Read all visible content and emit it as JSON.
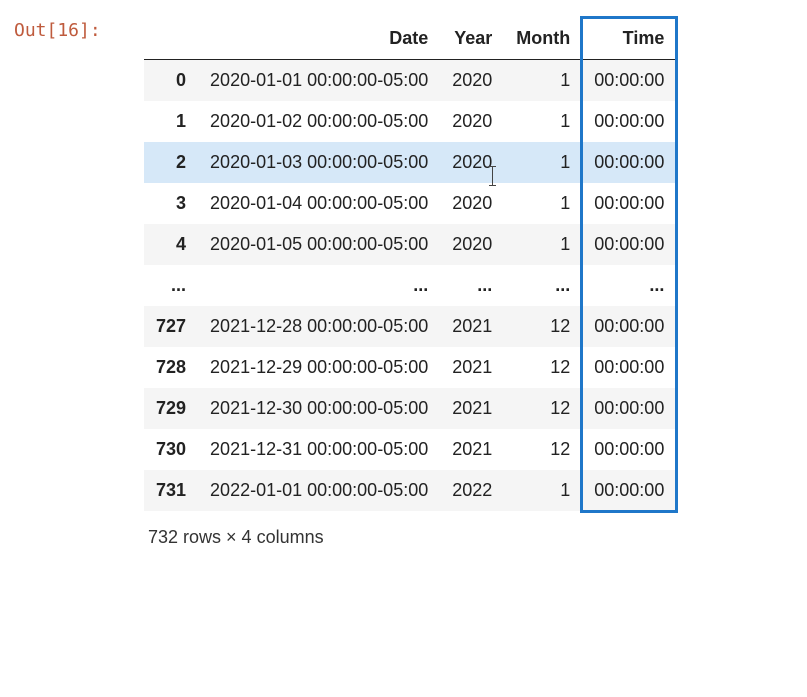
{
  "out_label": "Out[16]:",
  "columns": [
    "Date",
    "Year",
    "Month",
    "Time"
  ],
  "rows": [
    {
      "idx": "0",
      "Date": "2020-01-01 00:00:00-05:00",
      "Year": "2020",
      "Month": "1",
      "Time": "00:00:00",
      "parity": "odd"
    },
    {
      "idx": "1",
      "Date": "2020-01-02 00:00:00-05:00",
      "Year": "2020",
      "Month": "1",
      "Time": "00:00:00",
      "parity": "even"
    },
    {
      "idx": "2",
      "Date": "2020-01-03 00:00:00-05:00",
      "Year": "2020",
      "Month": "1",
      "Time": "00:00:00",
      "parity": "highlight",
      "cursor": true
    },
    {
      "idx": "3",
      "Date": "2020-01-04 00:00:00-05:00",
      "Year": "2020",
      "Month": "1",
      "Time": "00:00:00",
      "parity": "even"
    },
    {
      "idx": "4",
      "Date": "2020-01-05 00:00:00-05:00",
      "Year": "2020",
      "Month": "1",
      "Time": "00:00:00",
      "parity": "odd"
    },
    {
      "idx": "...",
      "Date": "...",
      "Year": "...",
      "Month": "...",
      "Time": "...",
      "parity": "even",
      "ellipsis": true
    },
    {
      "idx": "727",
      "Date": "2021-12-28 00:00:00-05:00",
      "Year": "2021",
      "Month": "12",
      "Time": "00:00:00",
      "parity": "odd"
    },
    {
      "idx": "728",
      "Date": "2021-12-29 00:00:00-05:00",
      "Year": "2021",
      "Month": "12",
      "Time": "00:00:00",
      "parity": "even"
    },
    {
      "idx": "729",
      "Date": "2021-12-30 00:00:00-05:00",
      "Year": "2021",
      "Month": "12",
      "Time": "00:00:00",
      "parity": "odd"
    },
    {
      "idx": "730",
      "Date": "2021-12-31 00:00:00-05:00",
      "Year": "2021",
      "Month": "12",
      "Time": "00:00:00",
      "parity": "even"
    },
    {
      "idx": "731",
      "Date": "2022-01-01 00:00:00-05:00",
      "Year": "2022",
      "Month": "1",
      "Time": "00:00:00",
      "parity": "odd"
    }
  ],
  "summary": "732 rows × 4 columns",
  "highlighted_column": "Time"
}
